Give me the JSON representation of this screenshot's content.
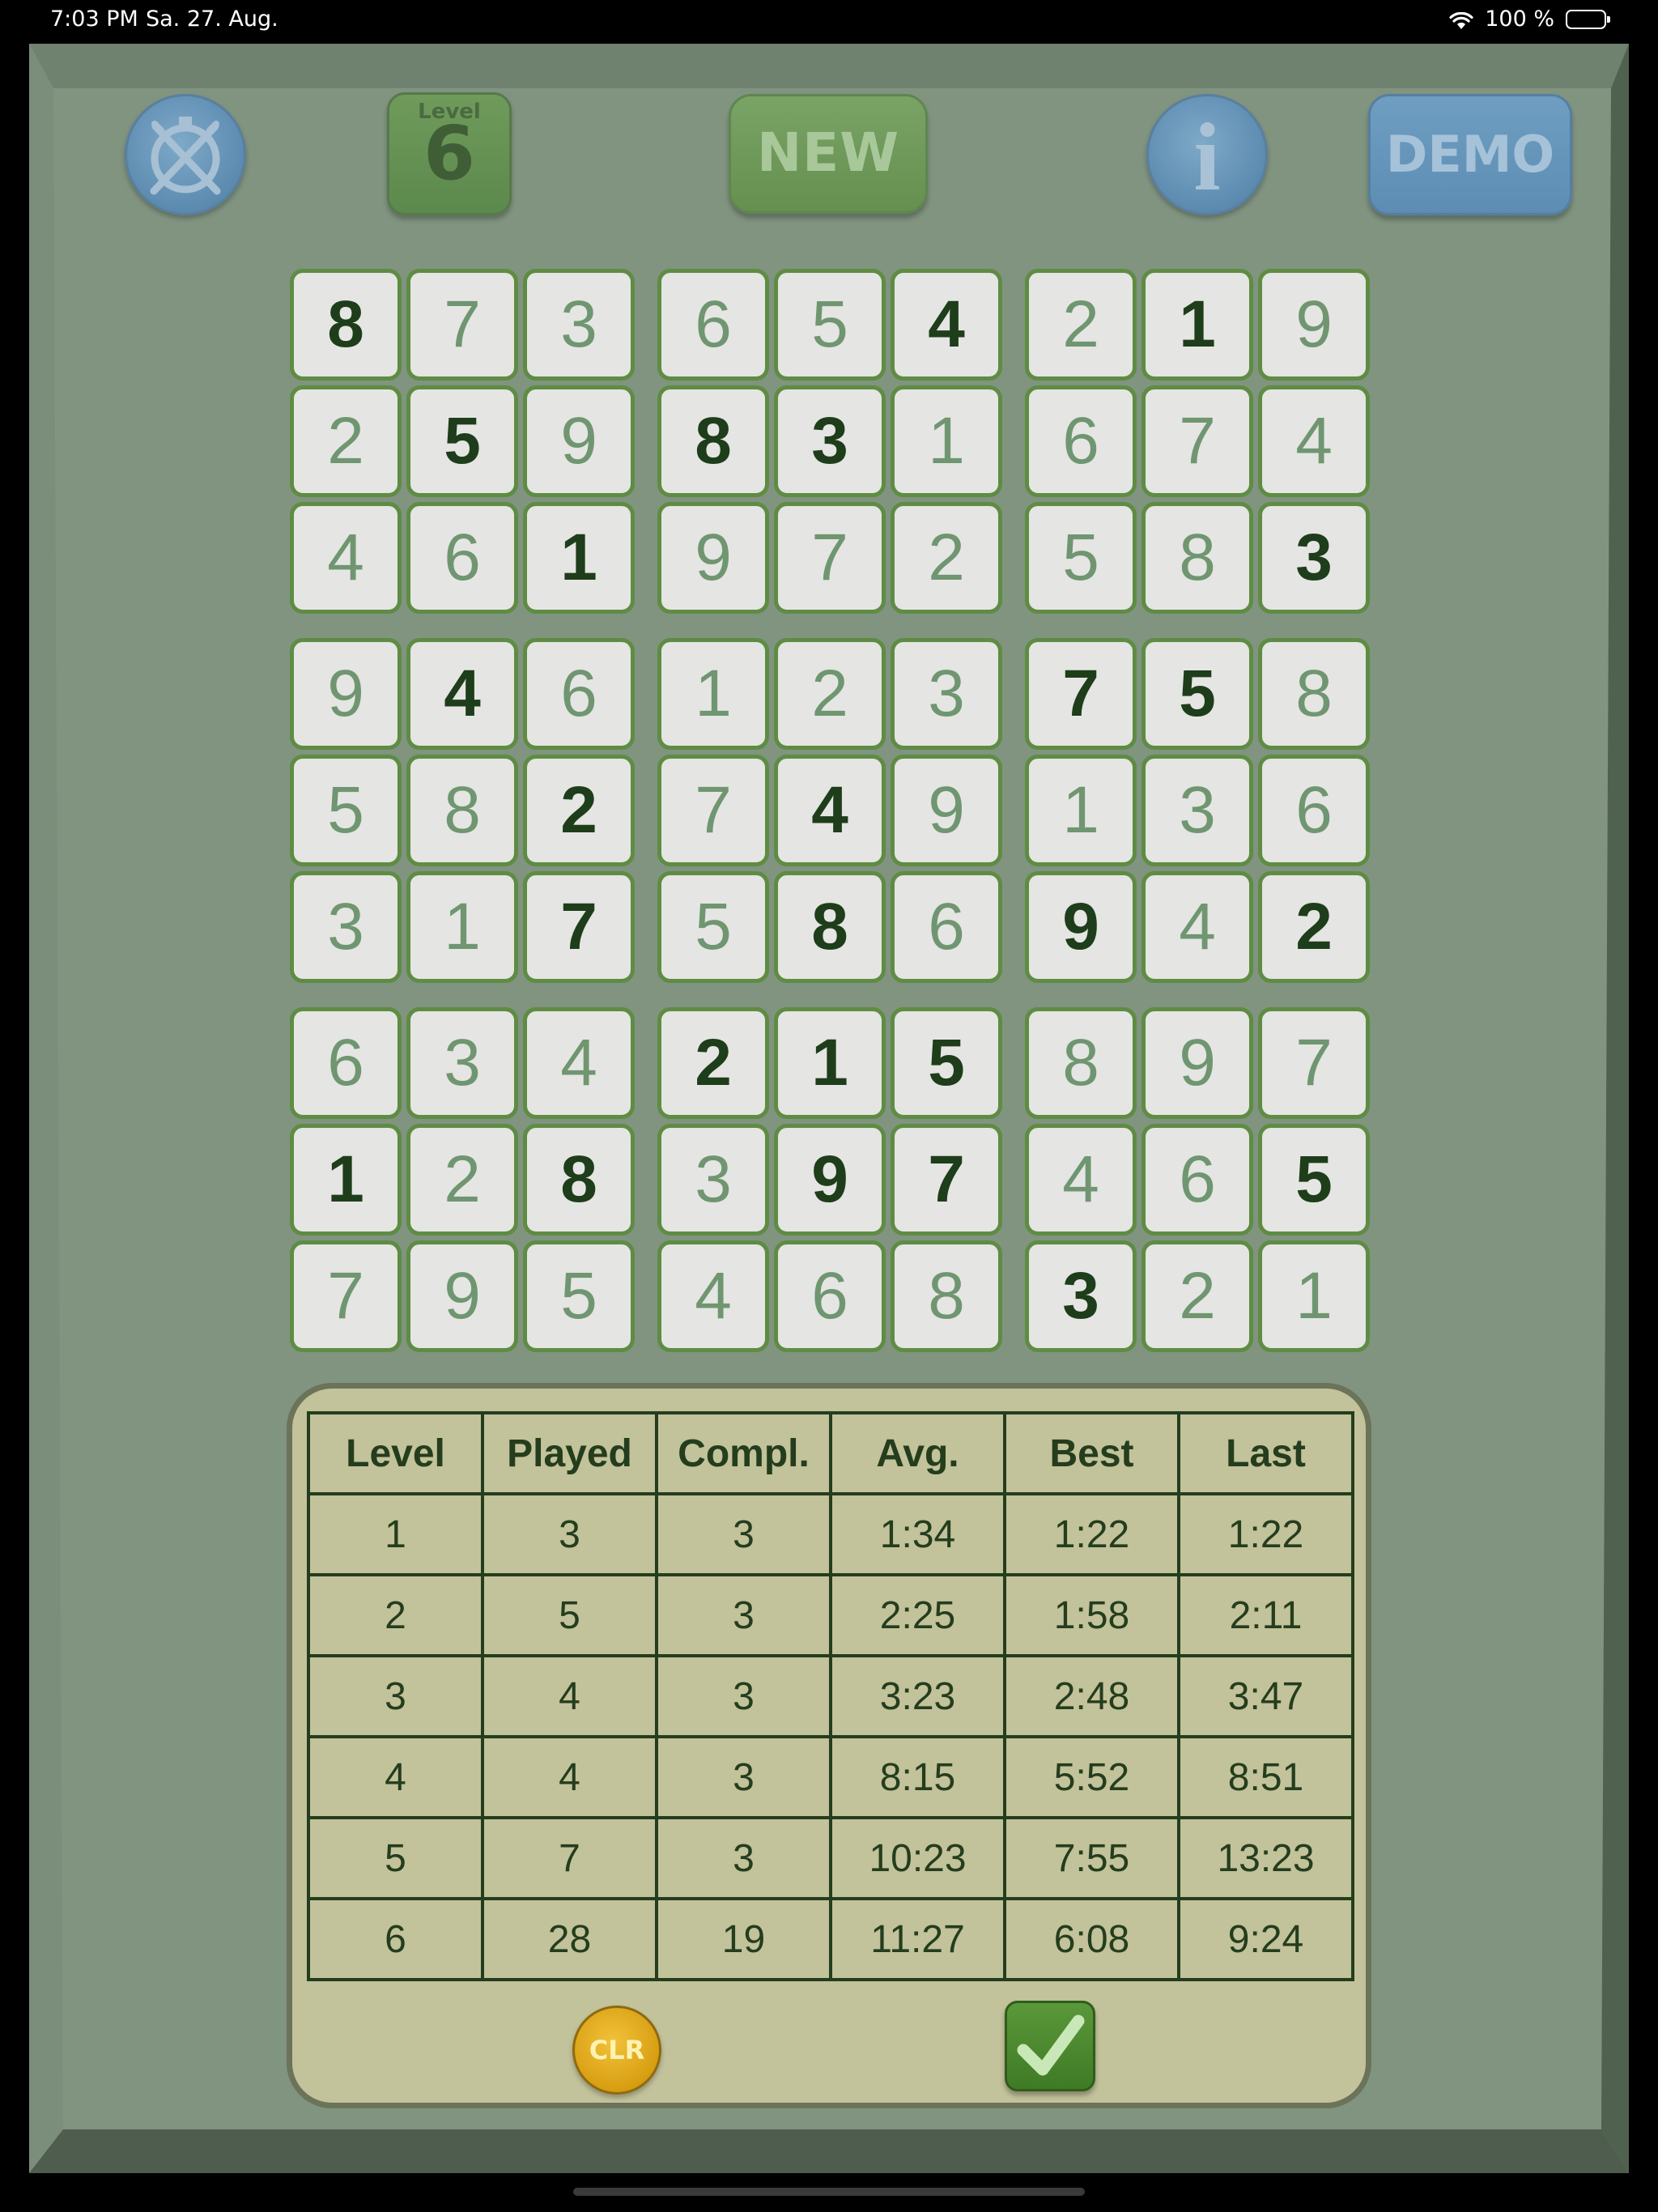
{
  "status_bar": {
    "time": "7:03 PM",
    "date": "Sa. 27. Aug.",
    "battery": "100 %"
  },
  "toolbar": {
    "level_label": "Level",
    "level_value": "6",
    "new_label": "NEW",
    "info_label": "i",
    "demo_label": "DEMO"
  },
  "board": {
    "rows": [
      [
        "8",
        "7",
        "3",
        "6",
        "5",
        "4",
        "2",
        "1",
        "9"
      ],
      [
        "2",
        "5",
        "9",
        "8",
        "3",
        "1",
        "6",
        "7",
        "4"
      ],
      [
        "4",
        "6",
        "1",
        "9",
        "7",
        "2",
        "5",
        "8",
        "3"
      ],
      [
        "9",
        "4",
        "6",
        "1",
        "2",
        "3",
        "7",
        "5",
        "8"
      ],
      [
        "5",
        "8",
        "2",
        "7",
        "4",
        "9",
        "1",
        "3",
        "6"
      ],
      [
        "3",
        "1",
        "7",
        "5",
        "8",
        "6",
        "9",
        "4",
        "2"
      ],
      [
        "6",
        "3",
        "4",
        "2",
        "1",
        "5",
        "8",
        "9",
        "7"
      ],
      [
        "1",
        "2",
        "8",
        "3",
        "9",
        "7",
        "4",
        "6",
        "5"
      ],
      [
        "7",
        "9",
        "5",
        "4",
        "6",
        "8",
        "3",
        "2",
        "1"
      ]
    ],
    "given": [
      [
        1,
        0,
        0,
        0,
        0,
        1,
        0,
        1,
        0
      ],
      [
        0,
        1,
        0,
        1,
        1,
        0,
        0,
        0,
        0
      ],
      [
        0,
        0,
        1,
        0,
        0,
        0,
        0,
        0,
        1
      ],
      [
        0,
        1,
        0,
        0,
        0,
        0,
        1,
        1,
        0
      ],
      [
        0,
        0,
        1,
        0,
        1,
        0,
        0,
        0,
        0
      ],
      [
        0,
        0,
        1,
        0,
        1,
        0,
        1,
        0,
        1
      ],
      [
        0,
        0,
        0,
        1,
        1,
        1,
        0,
        0,
        0
      ],
      [
        1,
        0,
        1,
        0,
        1,
        1,
        0,
        0,
        1
      ],
      [
        0,
        0,
        0,
        0,
        0,
        0,
        1,
        0,
        0
      ]
    ]
  },
  "stats": {
    "headers": [
      "Level",
      "Played",
      "Compl.",
      "Avg.",
      "Best",
      "Last"
    ],
    "rows": [
      [
        "1",
        "3",
        "3",
        "1:34",
        "1:22",
        "1:22"
      ],
      [
        "2",
        "5",
        "3",
        "2:25",
        "1:58",
        "2:11"
      ],
      [
        "3",
        "4",
        "3",
        "3:23",
        "2:48",
        "3:47"
      ],
      [
        "4",
        "4",
        "3",
        "8:15",
        "5:52",
        "8:51"
      ],
      [
        "5",
        "7",
        "3",
        "10:23",
        "7:55",
        "13:23"
      ],
      [
        "6",
        "28",
        "19",
        "11:27",
        "6:08",
        "9:24"
      ]
    ],
    "clear_label": "CLR"
  }
}
